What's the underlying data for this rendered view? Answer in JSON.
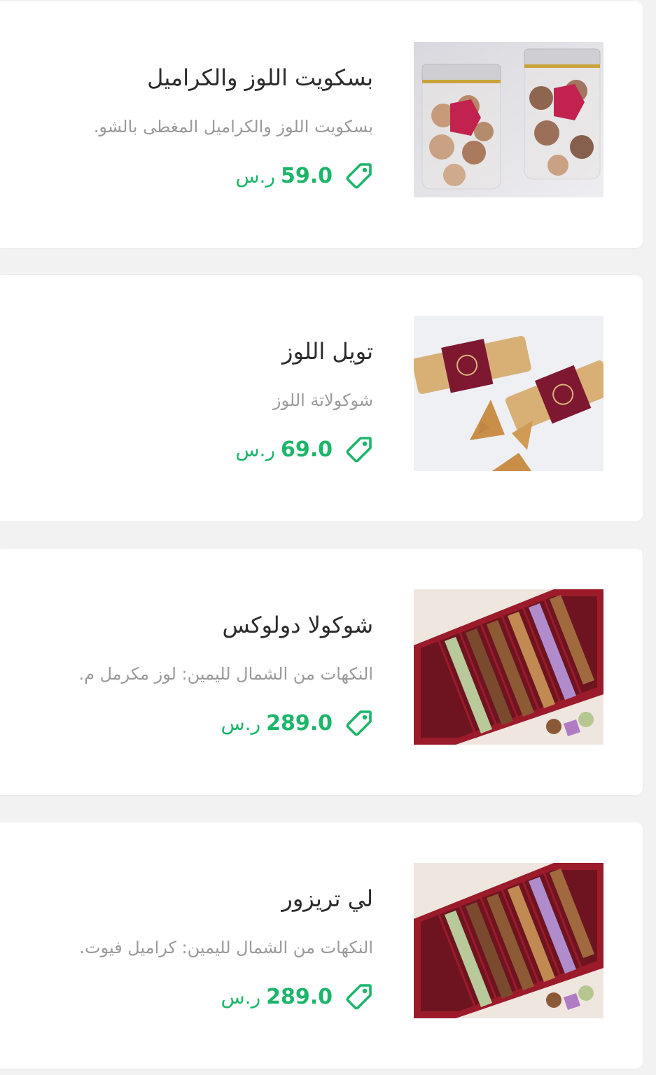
{
  "theme": {
    "price_color": "#1cb66a",
    "title_color": "#2b2b2b",
    "desc_color": "#9a9a9a"
  },
  "products": [
    {
      "title": "بسكويت اللوز والكراميل",
      "description": "بسكويت اللوز والكراميل المغطى بالشو.",
      "price": "59.0",
      "currency": "ر.س",
      "image": "almond-caramel-biscuit-jars",
      "icon": "price-tag-icon"
    },
    {
      "title": "تويل اللوز",
      "description": "شوكولاتة اللوز",
      "price": "69.0",
      "currency": "ر.س",
      "image": "almond-tuile-packs",
      "icon": "price-tag-icon"
    },
    {
      "title": "شوكولا دولوكس",
      "description": "النكهات من الشمال لليمين: لوز مكرمل م.",
      "price": "289.0",
      "currency": "ر.س",
      "image": "deluxe-chocolate-box",
      "icon": "price-tag-icon"
    },
    {
      "title": "لي تريزور",
      "description": "النكهات من الشمال لليمين: كراميل فيوت.",
      "price": "289.0",
      "currency": "ر.س",
      "image": "les-tresors-chocolate-box",
      "icon": "price-tag-icon"
    }
  ]
}
